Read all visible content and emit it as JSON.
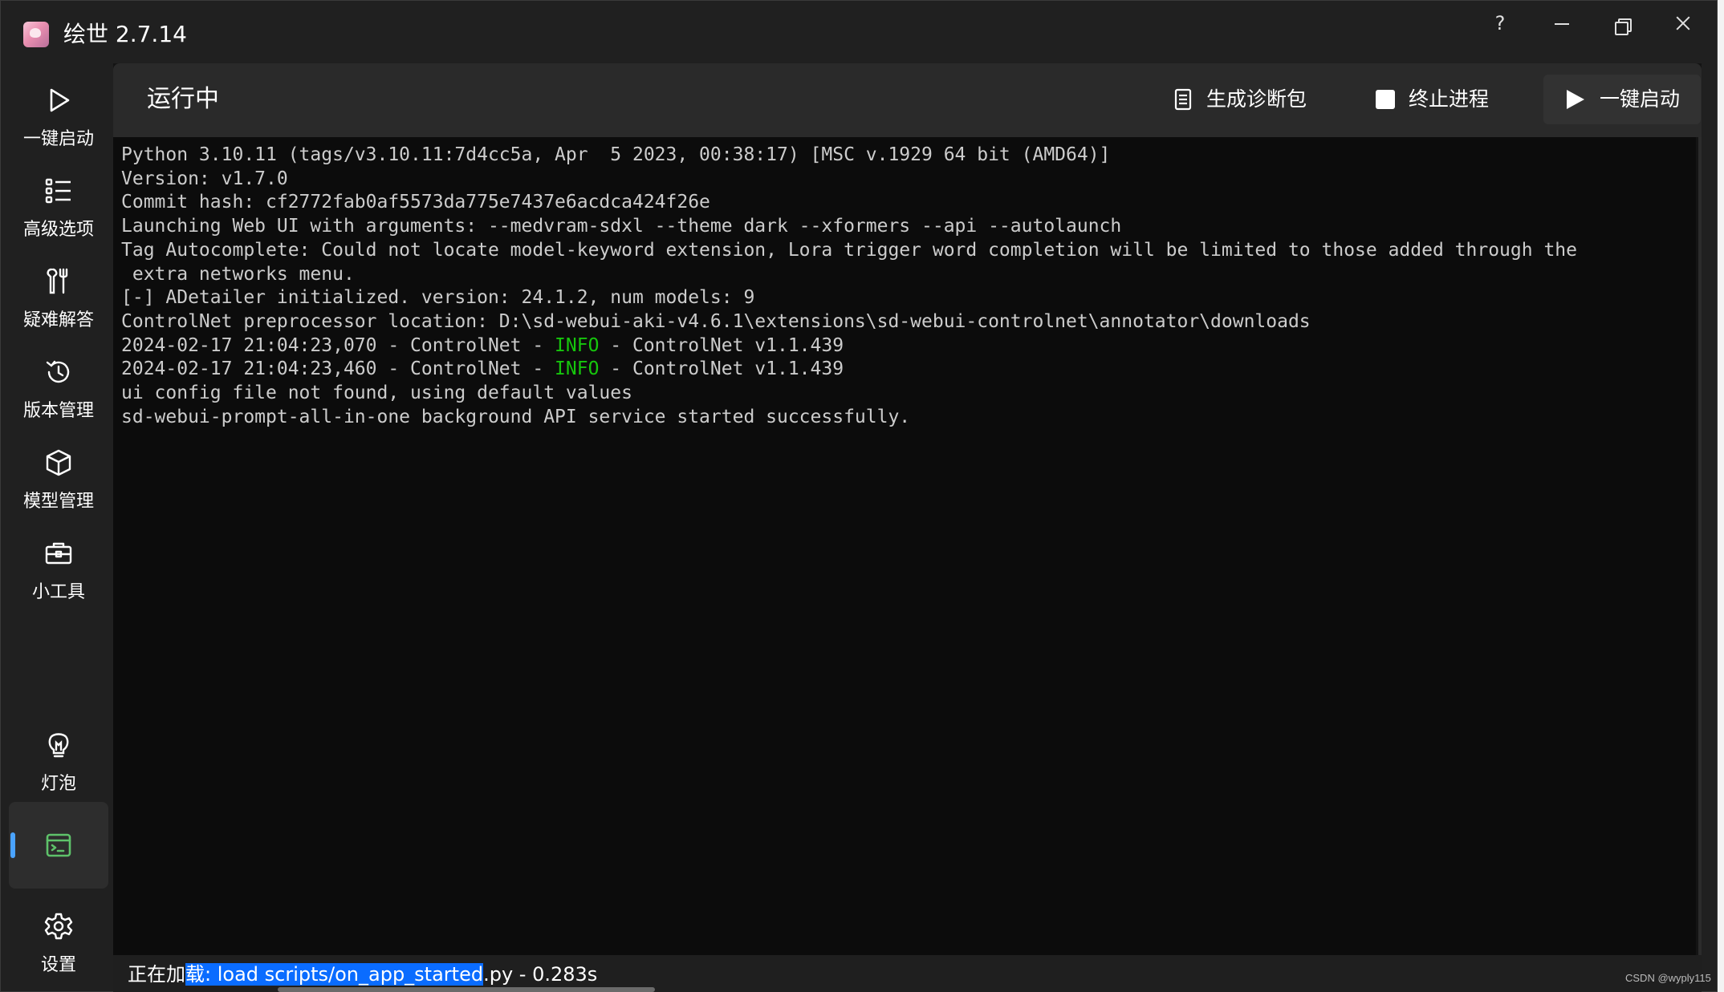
{
  "window": {
    "title": "绘世 2.7.14",
    "help_label": "?"
  },
  "sidebar": {
    "items": [
      {
        "label": "一键启动",
        "icon": "play-icon"
      },
      {
        "label": "高级选项",
        "icon": "list-icon"
      },
      {
        "label": "疑难解答",
        "icon": "tools-icon"
      },
      {
        "label": "版本管理",
        "icon": "history-icon"
      },
      {
        "label": "模型管理",
        "icon": "cube-icon"
      },
      {
        "label": "小工具",
        "icon": "toolbox-icon"
      },
      {
        "label": "灯泡",
        "icon": "lightbulb-icon"
      },
      {
        "label": "",
        "icon": "console-icon",
        "active": true
      },
      {
        "label": "设置",
        "icon": "gear-icon"
      }
    ]
  },
  "header": {
    "title": "运行中",
    "diag_label": "生成诊断包",
    "stop_label": "终止进程",
    "launch_label": "一键启动"
  },
  "console": {
    "lines": [
      "Python 3.10.11 (tags/v3.10.11:7d4cc5a, Apr  5 2023, 00:38:17) [MSC v.1929 64 bit (AMD64)]",
      "Version: v1.7.0",
      "Commit hash: cf2772fab0af5573da775e7437e6acdca424f26e",
      "Launching Web UI with arguments: --medvram-sdxl --theme dark --xformers --api --autolaunch",
      "Tag Autocomplete: Could not locate model-keyword extension, Lora trigger word completion will be limited to those added through the",
      " extra networks menu.",
      "[-] ADetailer initialized. version: 24.1.2, num models: 9",
      "ControlNet preprocessor location: D:\\sd-webui-aki-v4.6.1\\extensions\\sd-webui-controlnet\\annotator\\downloads",
      "ui config file not found, using default values",
      "sd-webui-prompt-all-in-one background API service started successfully."
    ],
    "log1": {
      "prefix": "2024-02-17 21:04:23,070 - ControlNet - ",
      "level": "INFO",
      "suffix": " - ControlNet v1.1.439"
    },
    "log2": {
      "prefix": "2024-02-17 21:04:23,460 - ControlNet - ",
      "level": "INFO",
      "suffix": " - ControlNet v1.1.439"
    },
    "info_color": "#16c60c"
  },
  "status": {
    "pre": "正在加",
    "highlight": "载: load scripts/on_app_started",
    "post": ".py - 0.283s"
  },
  "watermark": "CSDN @wyply115",
  "colors": {
    "accent": "#4aa3ff",
    "active_icon": "#5ec26a",
    "selection": "#0a6cff"
  }
}
